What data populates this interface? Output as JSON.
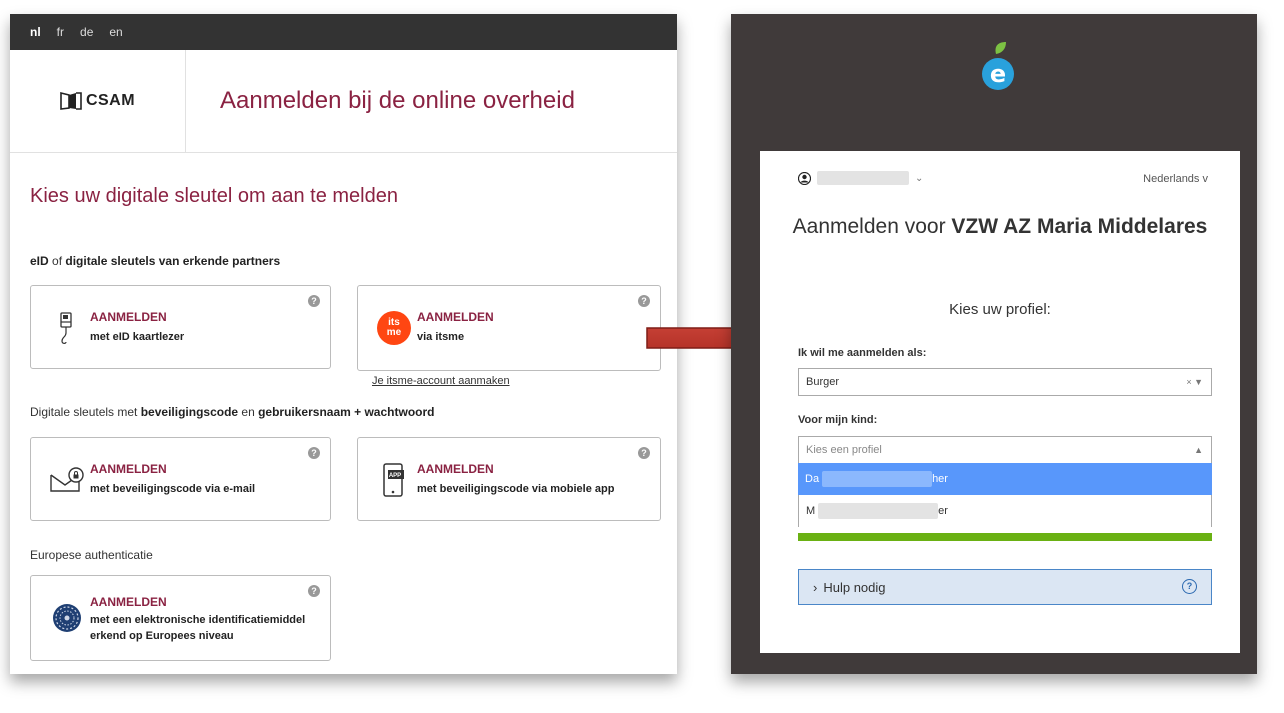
{
  "left_panel": {
    "languages": [
      {
        "label": "nl",
        "active": true
      },
      {
        "label": "fr",
        "active": false
      },
      {
        "label": "de",
        "active": false
      },
      {
        "label": "en",
        "active": false
      }
    ],
    "logo_text": "CSAM",
    "page_title": "Aanmelden bij de online overheid",
    "section_title": "Kies uw digitale sleutel om aan te melden",
    "group1": {
      "part1": "eID",
      "part2": " of ",
      "part3": "digitale sleutels van erkende partners"
    },
    "group2": {
      "part1": "Digitale sleutels met ",
      "part2": "beveiligingscode",
      "part3": " en ",
      "part4": "gebruikersnaam + wachtwoord"
    },
    "group3_label": "Europese authenticatie",
    "cards": [
      {
        "title": "AANMELDEN",
        "subtitle": "met eID kaartlezer",
        "icon": "card-reader-icon"
      },
      {
        "title": "AANMELDEN",
        "subtitle": "via itsme",
        "icon": "itsme-icon"
      },
      {
        "title": "AANMELDEN",
        "subtitle": "met beveiligingscode via e-mail",
        "icon": "email-lock-icon"
      },
      {
        "title": "AANMELDEN",
        "subtitle": "met beveiligingscode via mobiele app",
        "icon": "mobile-app-icon"
      },
      {
        "title": "AANMELDEN",
        "subtitle": "met een elektronische identificatiemiddel erkend op Europees niveau",
        "icon": "eu-stars-icon"
      }
    ],
    "help_glyph": "?",
    "itsme_logo_text": "its me",
    "app_badge": "APP",
    "itsme_link": "Je itsme-account aanmaken"
  },
  "right_panel": {
    "logo_letter": "e",
    "language_selector": "Nederlands",
    "heading_prefix": "Aanmelden voor ",
    "heading_org": "VZW AZ Maria Middelares",
    "choose_profile": "Kies uw profiel:",
    "login_as_label": "Ik wil me aanmelden als:",
    "login_as_value": "Burger",
    "child_label": "Voor mijn kind:",
    "child_placeholder": "Kies een profiel",
    "options": [
      {
        "prefix": "Da",
        "suffix": "her",
        "selected": true
      },
      {
        "prefix": "M",
        "suffix": "er",
        "selected": false
      }
    ],
    "help_button": "Hulp nodig",
    "colors": {
      "accent_maroon": "#8a2242",
      "select_highlight": "#5897fb",
      "green_bar": "#6ab113",
      "help_bg": "#dbe6f3"
    }
  }
}
